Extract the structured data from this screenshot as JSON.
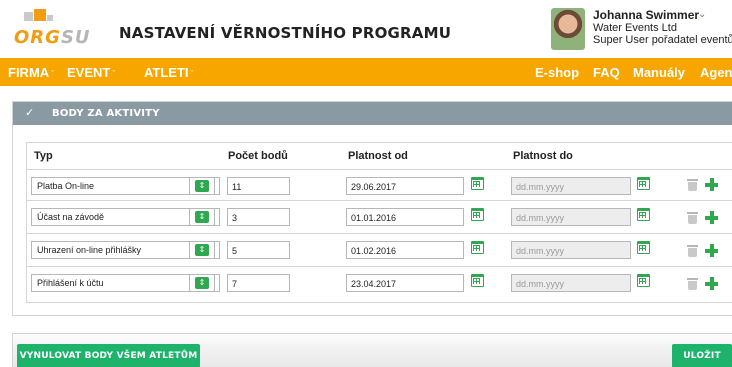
{
  "header": {
    "logo": {
      "text_main": "ORG",
      "text_accent": "SU"
    },
    "title": "NASTAVENÍ VĚRNOSTNÍHO PROGRAMU",
    "user": {
      "name": "Johanna Swimmer",
      "company": "Water Events Ltd",
      "role": "Super User pořadatel eventů"
    }
  },
  "nav": {
    "left": [
      {
        "label": "FIRMA",
        "chevron": "chevron-down-icon"
      },
      {
        "label": "EVENT",
        "chevron": "chevron-down-icon"
      },
      {
        "label": "ATLETI",
        "chevron": "chevron-down-icon"
      }
    ],
    "right": [
      "E-shop",
      "FAQ",
      "Manuály",
      "Agent"
    ]
  },
  "panel": {
    "title": "BODY ZA AKTIVITY",
    "columns": [
      "Typ",
      "Počet bodů",
      "Platnost od",
      "Platnost do"
    ],
    "rows": [
      {
        "type": "Platba On-line",
        "points": "11",
        "valid_from": "29.06.2017",
        "valid_to_placeholder": "dd.mm.yyyy"
      },
      {
        "type": "Účast na závodě",
        "points": "3",
        "valid_from": "01.01.2016",
        "valid_to_placeholder": "dd.mm.yyyy"
      },
      {
        "type": "Uhrazení on-line přihlášky",
        "points": "5",
        "valid_from": "01.02.2016",
        "valid_to_placeholder": "dd.mm.yyyy"
      },
      {
        "type": "Přihlášení k účtu",
        "points": "7",
        "valid_from": "23.04.2017",
        "valid_to_placeholder": "dd.mm.yyyy"
      }
    ]
  },
  "footer": {
    "reset_label": "VYNULOVAT BODY VŠEM ATLETŮM",
    "save_label": "ULOŽIT"
  },
  "colors": {
    "nav": "#f7a600",
    "panel_header": "#8a9aa3",
    "green": "#2fa84f",
    "button_green": "#1db36b",
    "logo_orange": "#f39c12"
  }
}
